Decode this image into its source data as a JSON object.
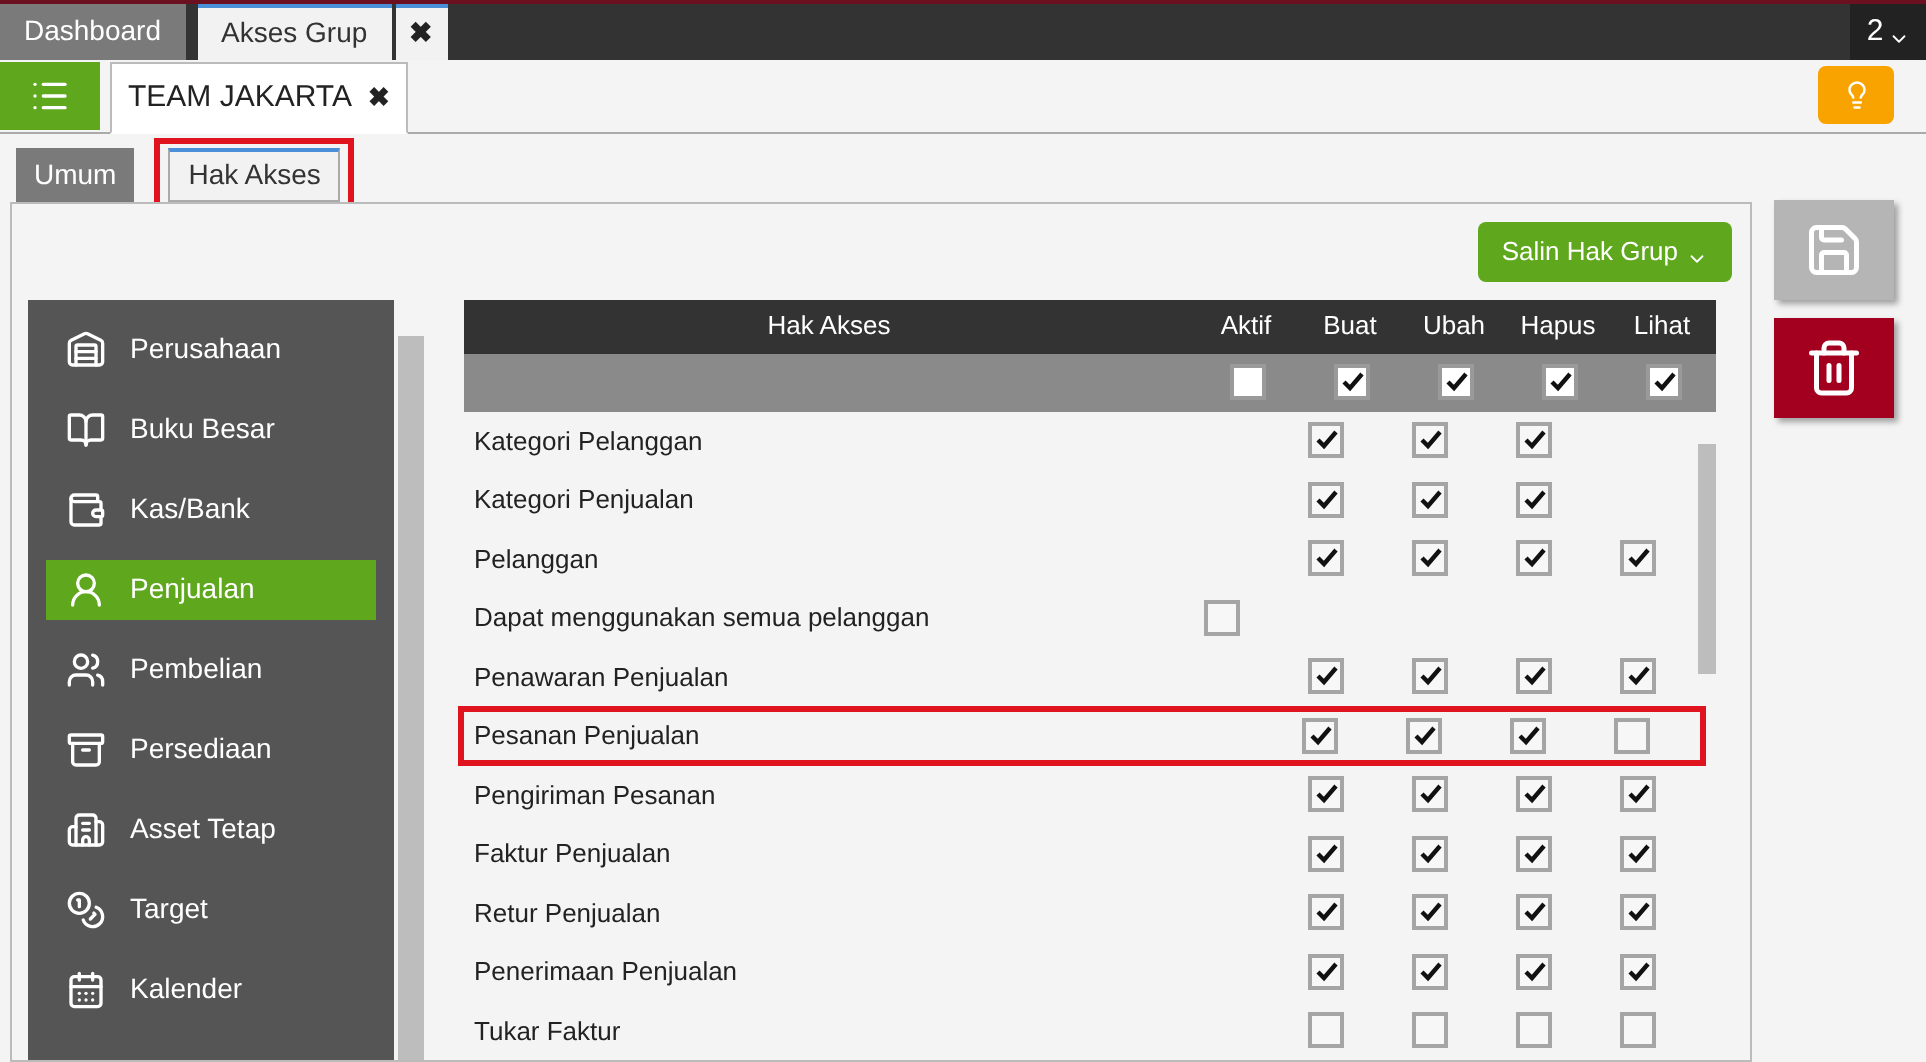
{
  "top_tabs": [
    {
      "label": "Dashboard",
      "selected": false
    },
    {
      "label": "Akses Grup",
      "selected": true
    }
  ],
  "top_close": "✖",
  "window_counter": "2",
  "form_tab": {
    "label": "TEAM JAKARTA",
    "close": "✖"
  },
  "sub_tabs": [
    {
      "label": "Umum",
      "selected": false,
      "highlighted": false
    },
    {
      "label": "Hak Akses",
      "selected": true,
      "highlighted": true
    }
  ],
  "copy_button": "Salin Hak Grup",
  "sidebar": {
    "items": [
      {
        "label": "Perusahaan",
        "kind": "company",
        "selected": false
      },
      {
        "label": "Buku Besar",
        "kind": "ledger",
        "selected": false
      },
      {
        "label": "Kas/Bank",
        "kind": "cash",
        "selected": false
      },
      {
        "label": "Penjualan",
        "kind": "sales",
        "selected": true
      },
      {
        "label": "Pembelian",
        "kind": "purchase",
        "selected": false
      },
      {
        "label": "Persediaan",
        "kind": "inventory",
        "selected": false
      },
      {
        "label": "Asset Tetap",
        "kind": "asset",
        "selected": false
      },
      {
        "label": "Target",
        "kind": "target",
        "selected": false
      },
      {
        "label": "Kalender",
        "kind": "calendar",
        "selected": false
      }
    ]
  },
  "table": {
    "label_column": "Hak Akses",
    "columns": [
      {
        "label": "Aktif",
        "all_checked": false
      },
      {
        "label": "Buat",
        "all_checked": true
      },
      {
        "label": "Ubah",
        "all_checked": true
      },
      {
        "label": "Hapus",
        "all_checked": true
      },
      {
        "label": "Lihat",
        "all_checked": true
      }
    ],
    "rows": [
      {
        "label": "Kategori Pelanggan",
        "highlighted": false,
        "cells": [
          {
            "kind": "blank"
          },
          {
            "kind": "checkbox",
            "checked": true
          },
          {
            "kind": "checkbox",
            "checked": true
          },
          {
            "kind": "checkbox",
            "checked": true
          },
          {
            "kind": "blank"
          }
        ]
      },
      {
        "label": "Kategori Penjualan",
        "highlighted": false,
        "cells": [
          {
            "kind": "blank"
          },
          {
            "kind": "checkbox",
            "checked": true
          },
          {
            "kind": "checkbox",
            "checked": true
          },
          {
            "kind": "checkbox",
            "checked": true
          },
          {
            "kind": "blank"
          }
        ]
      },
      {
        "label": "Pelanggan",
        "highlighted": false,
        "cells": [
          {
            "kind": "blank"
          },
          {
            "kind": "checkbox",
            "checked": true
          },
          {
            "kind": "checkbox",
            "checked": true
          },
          {
            "kind": "checkbox",
            "checked": true
          },
          {
            "kind": "checkbox",
            "checked": true
          }
        ]
      },
      {
        "label": "Dapat menggunakan semua pelanggan",
        "highlighted": false,
        "cells": [
          {
            "kind": "checkbox",
            "checked": false
          },
          {
            "kind": "blank"
          },
          {
            "kind": "blank"
          },
          {
            "kind": "blank"
          },
          {
            "kind": "blank"
          }
        ]
      },
      {
        "label": "Penawaran Penjualan",
        "highlighted": false,
        "cells": [
          {
            "kind": "blank"
          },
          {
            "kind": "checkbox",
            "checked": true
          },
          {
            "kind": "checkbox",
            "checked": true
          },
          {
            "kind": "checkbox",
            "checked": true
          },
          {
            "kind": "checkbox",
            "checked": true
          }
        ]
      },
      {
        "label": "Pesanan Penjualan",
        "highlighted": true,
        "cells": [
          {
            "kind": "blank"
          },
          {
            "kind": "checkbox",
            "checked": true
          },
          {
            "kind": "checkbox",
            "checked": true
          },
          {
            "kind": "checkbox",
            "checked": true
          },
          {
            "kind": "checkbox",
            "checked": false
          }
        ]
      },
      {
        "label": "Pengiriman Pesanan",
        "highlighted": false,
        "cells": [
          {
            "kind": "blank"
          },
          {
            "kind": "checkbox",
            "checked": true
          },
          {
            "kind": "checkbox",
            "checked": true
          },
          {
            "kind": "checkbox",
            "checked": true
          },
          {
            "kind": "checkbox",
            "checked": true
          }
        ]
      },
      {
        "label": "Faktur Penjualan",
        "highlighted": false,
        "cells": [
          {
            "kind": "blank"
          },
          {
            "kind": "checkbox",
            "checked": true
          },
          {
            "kind": "checkbox",
            "checked": true
          },
          {
            "kind": "checkbox",
            "checked": true
          },
          {
            "kind": "checkbox",
            "checked": true
          }
        ]
      },
      {
        "label": "Retur Penjualan",
        "highlighted": false,
        "cells": [
          {
            "kind": "blank"
          },
          {
            "kind": "checkbox",
            "checked": true
          },
          {
            "kind": "checkbox",
            "checked": true
          },
          {
            "kind": "checkbox",
            "checked": true
          },
          {
            "kind": "checkbox",
            "checked": true
          }
        ]
      },
      {
        "label": "Penerimaan Penjualan",
        "highlighted": false,
        "cells": [
          {
            "kind": "blank"
          },
          {
            "kind": "checkbox",
            "checked": true
          },
          {
            "kind": "checkbox",
            "checked": true
          },
          {
            "kind": "checkbox",
            "checked": true
          },
          {
            "kind": "checkbox",
            "checked": true
          }
        ]
      },
      {
        "label": "Tukar Faktur",
        "highlighted": false,
        "cells": [
          {
            "kind": "blank"
          },
          {
            "kind": "checkbox",
            "checked": false
          },
          {
            "kind": "checkbox",
            "checked": false
          },
          {
            "kind": "checkbox",
            "checked": false
          },
          {
            "kind": "checkbox",
            "checked": false
          }
        ]
      }
    ]
  }
}
